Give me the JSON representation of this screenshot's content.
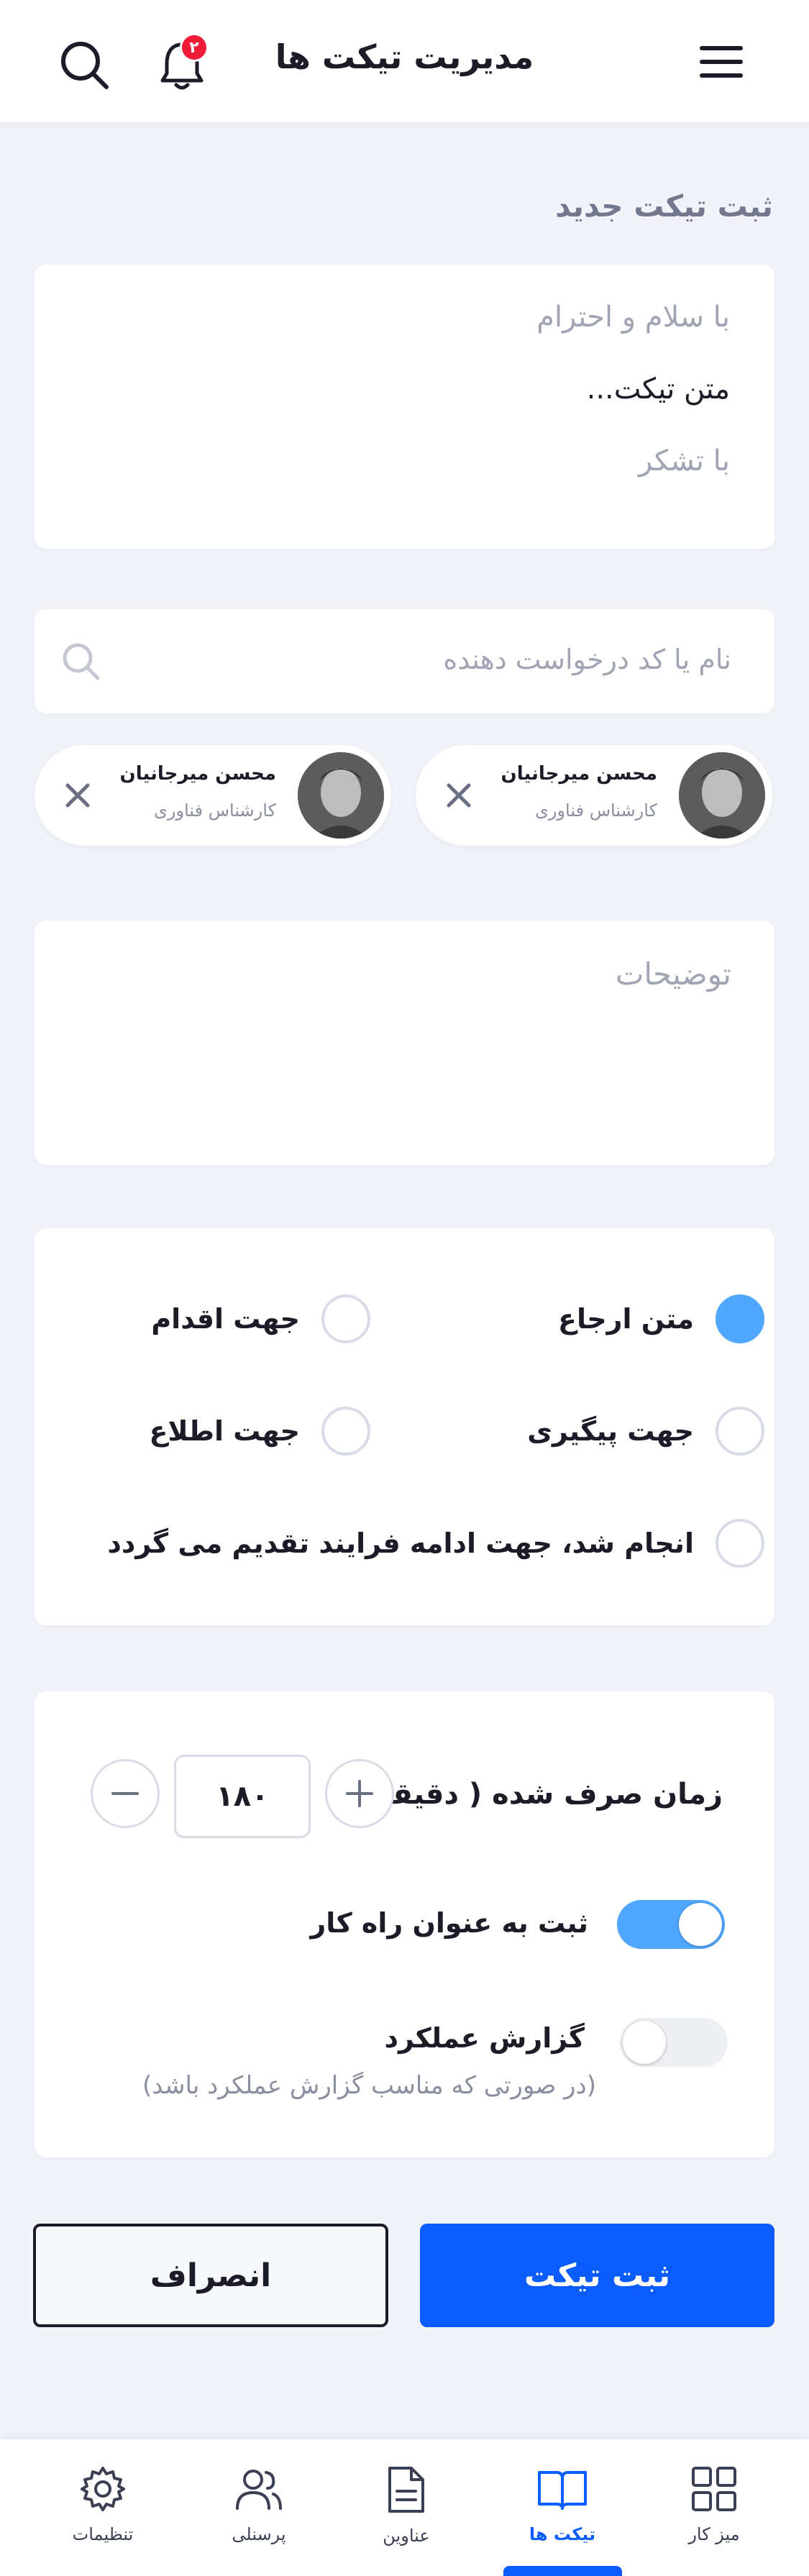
{
  "header": {
    "title": "مدیریت تیکت ها",
    "notification_count": "۲"
  },
  "form": {
    "section_title": "ثبت تیکت جدید",
    "ticket_text": {
      "greeting": "با سلام و احترام",
      "body": "متن تیکت...",
      "closing": "با تشکر"
    },
    "search": {
      "placeholder": "نام یا کد درخواست دهنده"
    },
    "recipients": [
      {
        "name": "محسن میرجانیان",
        "role": "کارشناس فناوری"
      },
      {
        "name": "محسن میرجانیان",
        "role": "کارشناس فناوری"
      }
    ],
    "description": {
      "placeholder": "توضیحات"
    },
    "options": [
      {
        "label": "متن ارجاع",
        "checked": true
      },
      {
        "label": "جهت اقدام",
        "checked": false
      },
      {
        "label": "جهت پیگیری",
        "checked": false
      },
      {
        "label": "جهت اطلاع",
        "checked": false
      },
      {
        "label": "انجام شد، جهت ادامه فرایند تقدیم می گردد",
        "checked": false
      }
    ],
    "time_spent": {
      "label": "زمان صرف شده ( دقیقه)",
      "value": "۱۸۰"
    },
    "toggles": [
      {
        "label": "ثبت به عنوان راه کار",
        "on": true
      },
      {
        "label": "گزارش عملکرد",
        "on": false,
        "hint": "(در صورتی که مناسب گزارش عملکرد باشد)"
      }
    ],
    "submit_label": "ثبت تیکت",
    "cancel_label": "انصراف"
  },
  "bottom_nav": {
    "items": [
      {
        "label": "میز کار",
        "icon": "grid-icon",
        "active": false
      },
      {
        "label": "تیکت ها",
        "icon": "book-icon",
        "active": true
      },
      {
        "label": "عناوین",
        "icon": "document-icon",
        "active": false
      },
      {
        "label": "پرسنلی",
        "icon": "users-icon",
        "active": false
      },
      {
        "label": "تنظیمات",
        "icon": "gear-icon",
        "active": false
      }
    ]
  },
  "colors": {
    "primary": "#0a5cff",
    "accent": "#4fa7ff",
    "badge": "#ef1b37",
    "background": "#f1f3f9"
  }
}
